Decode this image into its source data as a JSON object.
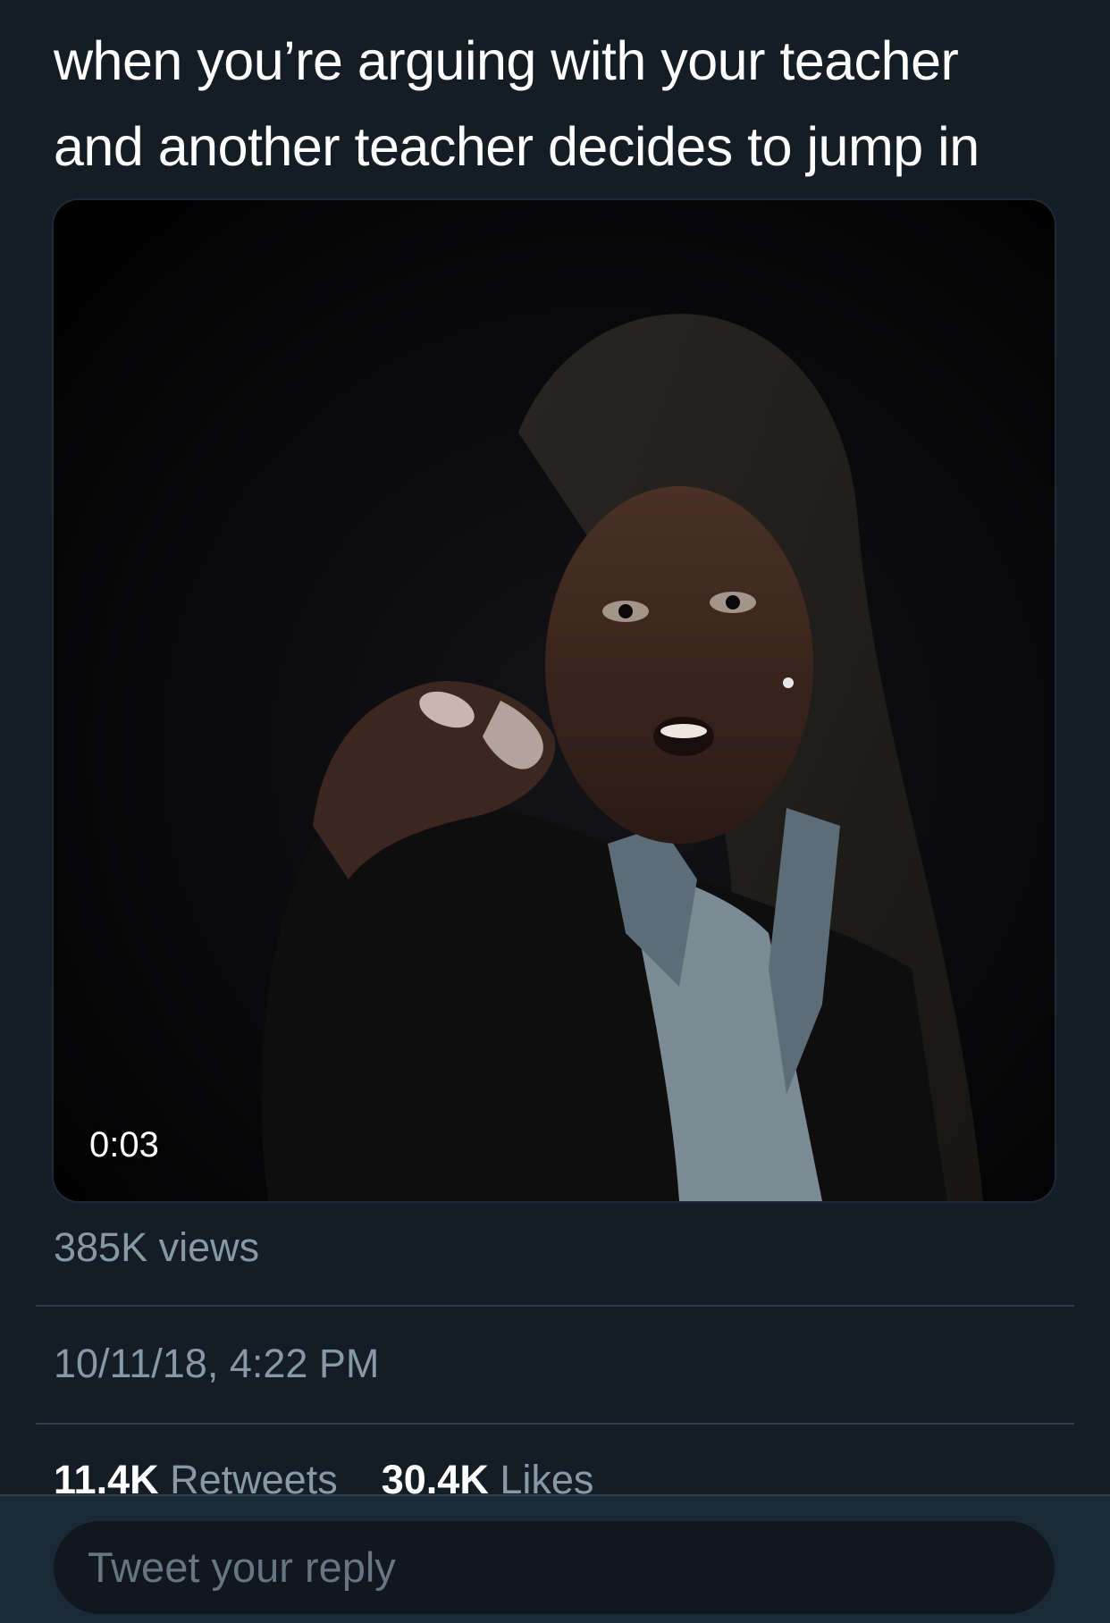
{
  "tweet": {
    "text_line1": "when you’re arguing with your teacher",
    "text_line2": "and another teacher decides to jump in"
  },
  "media": {
    "duration": "0:03",
    "views": "385K views"
  },
  "meta": {
    "timestamp": "10/11/18, 4:22 PM"
  },
  "stats": {
    "retweets_count": "11.4K",
    "retweets_label": "Retweets",
    "likes_count": "30.4K",
    "likes_label": "Likes"
  },
  "reply": {
    "placeholder": "Tweet your reply"
  },
  "colors": {
    "background": "#141d26",
    "secondary_text": "#8899a6",
    "reply_bar": "#1b2836"
  }
}
